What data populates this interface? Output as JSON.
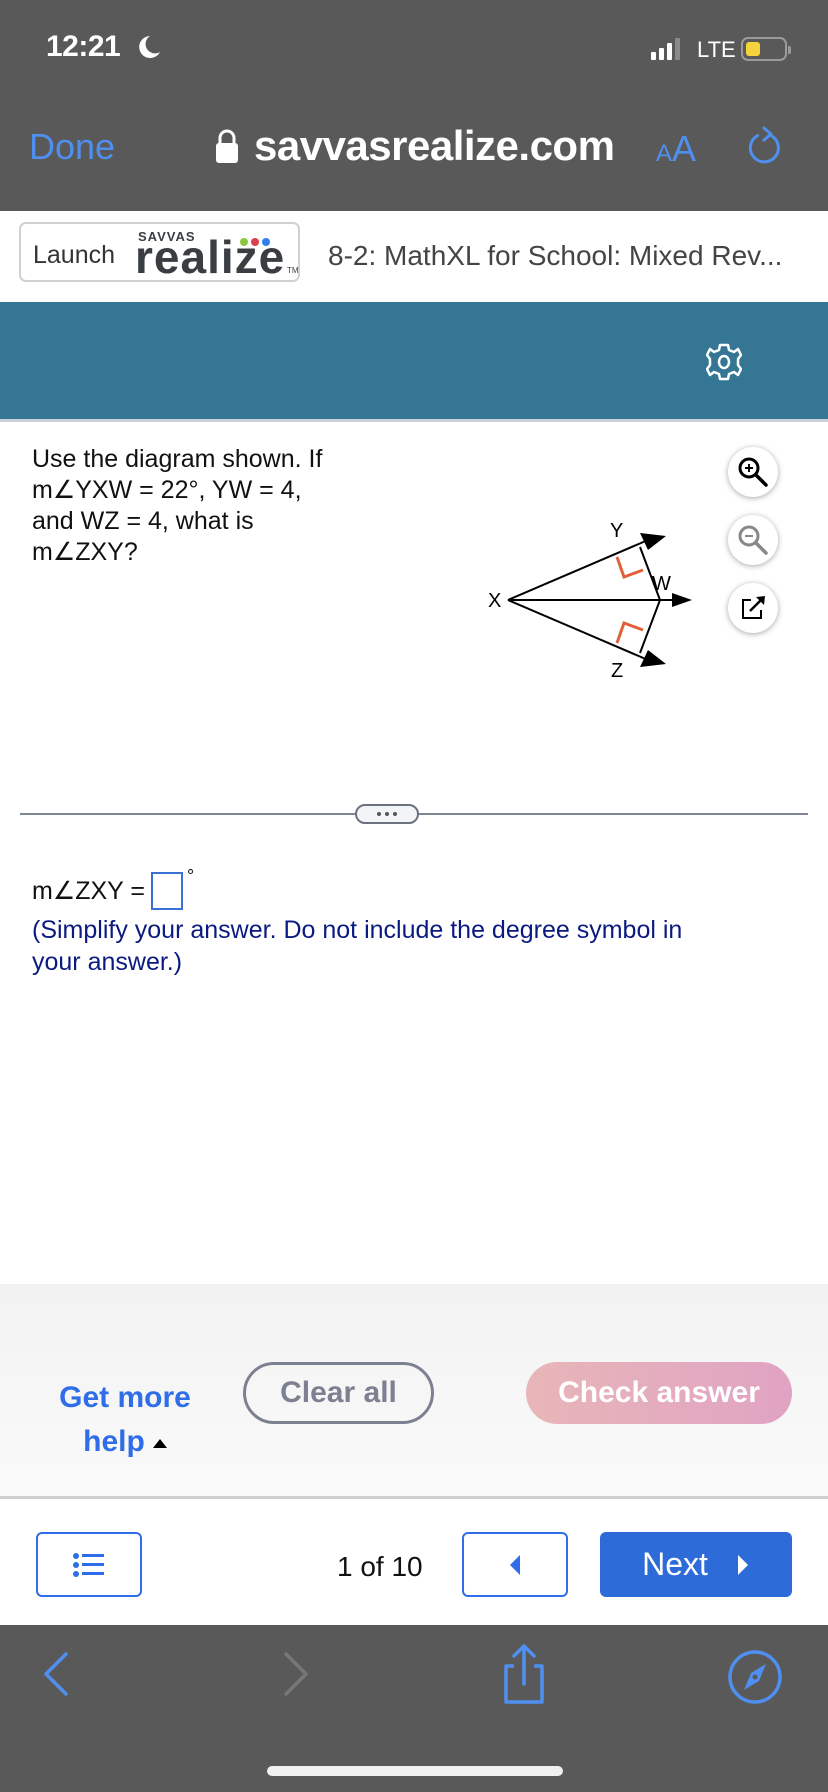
{
  "status_bar": {
    "time": "12:21",
    "network": "LTE",
    "icons": [
      "moon-icon",
      "signal-icon",
      "battery-icon"
    ]
  },
  "browser": {
    "done_label": "Done",
    "url": "savvasrealize.com",
    "text_size_label_small": "A",
    "text_size_label_big": "A",
    "icons": [
      "lock-icon",
      "reload-icon"
    ]
  },
  "header": {
    "launch_label": "Launch",
    "brand_top": "SAVVAS",
    "brand_name": "realize",
    "brand_tm": "TM",
    "brand_dot_colors": [
      "#8cc63f",
      "#d9414f",
      "#2f80ed"
    ],
    "assignment_title": "8-2: MathXL for School: Mixed Rev..."
  },
  "toolbar": {
    "accent_color": "#347694",
    "settings_icon": "gear-icon"
  },
  "question": {
    "lines": [
      "Use the diagram shown. If",
      "m∠YXW = 22°, YW = 4,",
      "and WZ = 4, what is",
      "m∠ZXY?"
    ],
    "diagram_labels": {
      "x": "X",
      "y": "Y",
      "w": "W",
      "z": "Z"
    },
    "tools": [
      "zoom-in-icon",
      "zoom-out-icon",
      "popout-icon"
    ]
  },
  "answer": {
    "prompt": "m∠ZXY =",
    "value": "",
    "unit": "°",
    "instructions": "(Simplify your answer. Do not include the degree symbol in your answer.)"
  },
  "actions": {
    "help_line1": "Get more",
    "help_line2": "help",
    "clear_all": "Clear all",
    "check_answer": "Check answer"
  },
  "navigation": {
    "page_count": "1 of 10",
    "next_label": "Next"
  },
  "safari_toolbar": {
    "icons": [
      "back-icon",
      "forward-icon",
      "share-icon",
      "compass-icon"
    ]
  }
}
